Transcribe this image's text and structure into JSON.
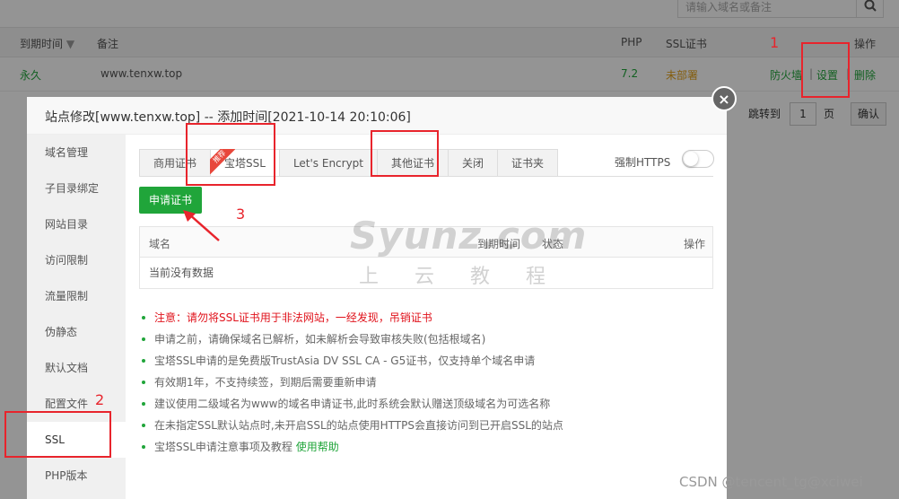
{
  "background": {
    "search_placeholder": "请输入域名或备注",
    "headers": {
      "expire": "到期时间",
      "remark": "备注",
      "php": "PHP",
      "ssl": "SSL证书",
      "ops": "操作"
    },
    "row": {
      "expire": "永久",
      "remark": "www.tenxw.top",
      "php": "7.2",
      "ssl": "未部署",
      "firewall": "防火墙",
      "settings": "设置",
      "delete": "删除",
      "sep": "|"
    },
    "pager": {
      "jump_to": "跳转到",
      "page_value": "1",
      "page_unit": "页",
      "confirm": "确认"
    }
  },
  "modal": {
    "title": "站点修改[www.tenxw.top] -- 添加时间[2021-10-14 20:10:06]",
    "close": "×",
    "sidebar": [
      {
        "label": "域名管理"
      },
      {
        "label": "子目录绑定"
      },
      {
        "label": "网站目录"
      },
      {
        "label": "访问限制"
      },
      {
        "label": "流量限制"
      },
      {
        "label": "伪静态"
      },
      {
        "label": "默认文档"
      },
      {
        "label": "配置文件"
      },
      {
        "label": "SSL"
      },
      {
        "label": "PHP版本"
      }
    ],
    "tabs": [
      {
        "label": "商用证书"
      },
      {
        "label": "宝塔SSL"
      },
      {
        "label": "Let's Encrypt"
      },
      {
        "label": "其他证书"
      },
      {
        "label": "关闭"
      },
      {
        "label": "证书夹"
      }
    ],
    "recommend_badge": "推荐",
    "force_https": "强制HTTPS",
    "force_https_on": false,
    "apply_button": "申请证书",
    "table": {
      "headers": {
        "domain": "域名",
        "expire": "到期时间",
        "status": "状态",
        "ops": "操作"
      },
      "empty": "当前没有数据"
    },
    "tips": [
      "注意：请勿将SSL证书用于非法网站，一经发现，吊销证书",
      "申请之前，请确保域名已解析，如未解析会导致审核失败(包括根域名)",
      "宝塔SSL申请的是免费版TrustAsia DV SSL CA - G5证书，仅支持单个域名申请",
      "有效期1年，不支持续签，到期后需要重新申请",
      "建议使用二级域名为www的域名申请证书,此时系统会默认赠送顶级域名为可选名称",
      "在未指定SSL默认站点时,未开启SSL的站点使用HTTPS会直接访问到已开启SSL的站点",
      "宝塔SSL申请注意事项及教程"
    ],
    "help_link": "使用帮助"
  },
  "watermark": {
    "text": "Syunz.com",
    "cn": "上云教程"
  },
  "annotations": {
    "n1": "1",
    "n2": "2",
    "n3": "3"
  },
  "credit": "CSDN @tencent_tg@xciwei",
  "colors": {
    "accent_green": "#20a53a",
    "annotation_red": "#e8242c",
    "warning_orange": "#e3a21a"
  }
}
